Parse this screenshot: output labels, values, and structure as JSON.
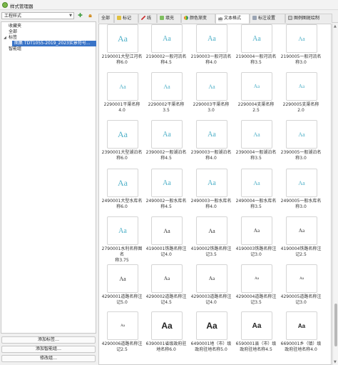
{
  "window": {
    "title": "样式管理器"
  },
  "left_panel": {
    "style_db": "工程样式",
    "tree": [
      "收藏夹",
      "全部",
      "标签",
      "图集 TDT1055-2019_2023实景符号...",
      "智能组"
    ],
    "buttons": [
      "添加标签…",
      "添加智能组…",
      "修改组…"
    ]
  },
  "tabs": [
    "全部",
    "标记",
    "线",
    "填充",
    "颜色渐变",
    "文本格式",
    "标注设置",
    "图例图斑绘制"
  ],
  "active_tab": 5,
  "colors": {
    "accent": "#3a74c7",
    "teal": "#4fb0c8"
  },
  "styles": [
    {
      "l1": "2190001大型江河名",
      "l2": "称6.0",
      "icon": "Aa",
      "kind": "blue-serif-lg"
    },
    {
      "l1": "2190002一般河流名",
      "l2": "称4.5",
      "icon": "Aa",
      "kind": "blue-serif"
    },
    {
      "l1": "2190003一般河流名",
      "l2": "称4.0",
      "icon": "Aa",
      "kind": "blue-serif"
    },
    {
      "l1": "2190004一般河流名",
      "l2": "称3.5",
      "icon": "Aa",
      "kind": "blue-serif"
    },
    {
      "l1": "2190005一般河流名",
      "l2": "称3.0",
      "icon": "Aa",
      "kind": "blue-serif-sm"
    },
    {
      "l1": "2290001干渠名称4.0",
      "l2": "",
      "icon": "Aa",
      "kind": "blue-serif-sm"
    },
    {
      "l1": "2290002干渠名称3.5",
      "l2": "",
      "icon": "Aa",
      "kind": "blue-serif-sm"
    },
    {
      "l1": "2290003干渠名称3.0",
      "l2": "",
      "icon": "Aa",
      "kind": "blue-serif-sm"
    },
    {
      "l1": "2290004支渠名称2.5",
      "l2": "",
      "icon": "Aa",
      "kind": "blue-serif-xs"
    },
    {
      "l1": "2290005支渠名称2.0",
      "l2": "",
      "icon": "Aa",
      "kind": "blue-serif-xs"
    },
    {
      "l1": "2390001大型湖泊名",
      "l2": "称6.0",
      "icon": "Aa",
      "kind": "blue-serif-lg"
    },
    {
      "l1": "2390002一般湖泊名",
      "l2": "称4.5",
      "icon": "Aa",
      "kind": "blue-serif"
    },
    {
      "l1": "2390003一般湖泊名",
      "l2": "称4.0",
      "icon": "Aa",
      "kind": "blue-serif"
    },
    {
      "l1": "2390004一般湖泊名",
      "l2": "称3.5",
      "icon": "Aa",
      "kind": "blue-serif-sm"
    },
    {
      "l1": "2390005一般湖泊名",
      "l2": "称3.0",
      "icon": "Aa",
      "kind": "blue-serif-sm"
    },
    {
      "l1": "2490001大型水库名",
      "l2": "称6.0",
      "icon": "Aa",
      "kind": "blue-serif-lg"
    },
    {
      "l1": "2490002一般水库名",
      "l2": "称4.5",
      "icon": "Aa",
      "kind": "blue-serif"
    },
    {
      "l1": "2490003一般水库名",
      "l2": "称4.0",
      "icon": "Aa",
      "kind": "blue-serif"
    },
    {
      "l1": "2490004一般水库名",
      "l2": "称3.5",
      "icon": "Aa",
      "kind": "blue-serif-sm"
    },
    {
      "l1": "2490005一般水库名",
      "l2": "称3.0",
      "icon": "Aa",
      "kind": "blue-serif-sm"
    },
    {
      "l1": "2790001水利名称图名",
      "l2": "称3.75",
      "icon": "Aa",
      "kind": "blue-serif"
    },
    {
      "l1": "4190001铁路名称注",
      "l2": "记4.0",
      "icon": "Aa",
      "kind": "dark-serif"
    },
    {
      "l1": "4190002铁路名称注",
      "l2": "记3.5",
      "icon": "Aa",
      "kind": "dark-serif"
    },
    {
      "l1": "4190003铁路名称注",
      "l2": "记3.0",
      "icon": "Aa",
      "kind": "dark-serif-sm"
    },
    {
      "l1": "4190004铁路名称注",
      "l2": "记2.5",
      "icon": "Aa",
      "kind": "dark-serif-sm"
    },
    {
      "l1": "4290001道路名称注",
      "l2": "记5.0",
      "icon": "Aa",
      "kind": "dark-serif"
    },
    {
      "l1": "4290002道路名称注",
      "l2": "记4.5",
      "icon": "Aa",
      "kind": "dark-serif-sm"
    },
    {
      "l1": "4290003道路名称注",
      "l2": "记4.0",
      "icon": "Aa",
      "kind": "dark-serif-sm"
    },
    {
      "l1": "4290004道路名称注",
      "l2": "记3.5",
      "icon": "Aa",
      "kind": "dark-serif-xs"
    },
    {
      "l1": "4290005道路名称注",
      "l2": "记3.0",
      "icon": "Aa",
      "kind": "dark-serif-xs"
    },
    {
      "l1": "4290006道路名称注",
      "l2": "记2.5",
      "icon": "Aa",
      "kind": "dark-serif-xs"
    },
    {
      "l1": "6390001省级政府驻",
      "l2": "地名称6.0",
      "icon": "Aa",
      "kind": "dark-sans-lg"
    },
    {
      "l1": "6490001地（市）级",
      "l2": "政府驻地名称5.0",
      "icon": "Aa",
      "kind": "dark-sans-lg"
    },
    {
      "l1": "6590001县（市）级",
      "l2": "政府驻地名称4.5",
      "icon": "Aa",
      "kind": "dark-sans"
    },
    {
      "l1": "6690001乡（镇）级",
      "l2": "政府驻地名称4.0",
      "icon": "Aa",
      "kind": "dark-sans-sm"
    }
  ]
}
